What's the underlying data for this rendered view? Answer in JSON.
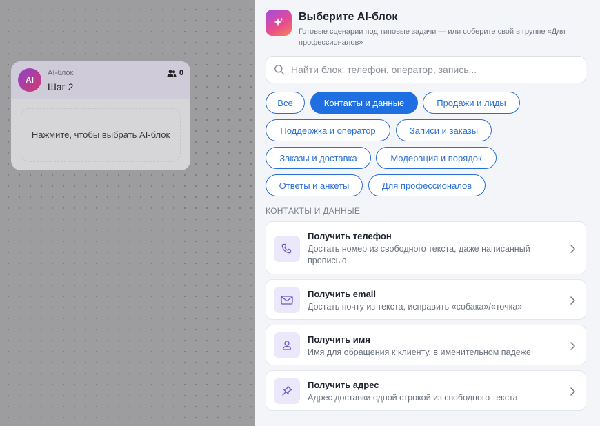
{
  "node": {
    "avatar": "AI",
    "type_label": "AI-блок",
    "title": "Шаг 2",
    "count": "0",
    "placeholder": "Нажмите, чтобы выбрать AI-блок"
  },
  "panel": {
    "title": "Выберите AI-блок",
    "subtitle": "Готовые сценарии под типовые задачи — или соберите свой в группе «Для профессионалов»",
    "search_placeholder": "Найти блок: телефон, оператор, запись...",
    "chips": [
      {
        "label": "Все",
        "active": false
      },
      {
        "label": "Контакты и данные",
        "active": true
      },
      {
        "label": "Продажи и лиды",
        "active": false
      },
      {
        "label": "Поддержка и оператор",
        "active": false
      },
      {
        "label": "Записи и заказы",
        "active": false
      },
      {
        "label": "Заказы и доставка",
        "active": false
      },
      {
        "label": "Модерация и порядок",
        "active": false
      },
      {
        "label": "Ответы и анкеты",
        "active": false
      },
      {
        "label": "Для профессионалов",
        "active": false
      }
    ],
    "section_label": "КОНТАКТЫ И ДАННЫЕ",
    "cards": [
      {
        "title": "Получить телефон",
        "desc": "Достать номер из свободного текста, даже написанный прописью",
        "icon": "phone-icon"
      },
      {
        "title": "Получить email",
        "desc": "Достать почту из текста, исправить «собака»/«точка»",
        "icon": "mail-icon"
      },
      {
        "title": "Получить имя",
        "desc": "Имя для обращения к клиенту, в именительном падеже",
        "icon": "user-icon"
      },
      {
        "title": "Получить адрес",
        "desc": "Адрес доставки одной строкой из свободного текста",
        "icon": "pin-icon"
      }
    ]
  },
  "colors": {
    "accent": "#1f6fe2",
    "icon_bg": "#ece8fb",
    "icon_stroke": "#6f56c9"
  }
}
